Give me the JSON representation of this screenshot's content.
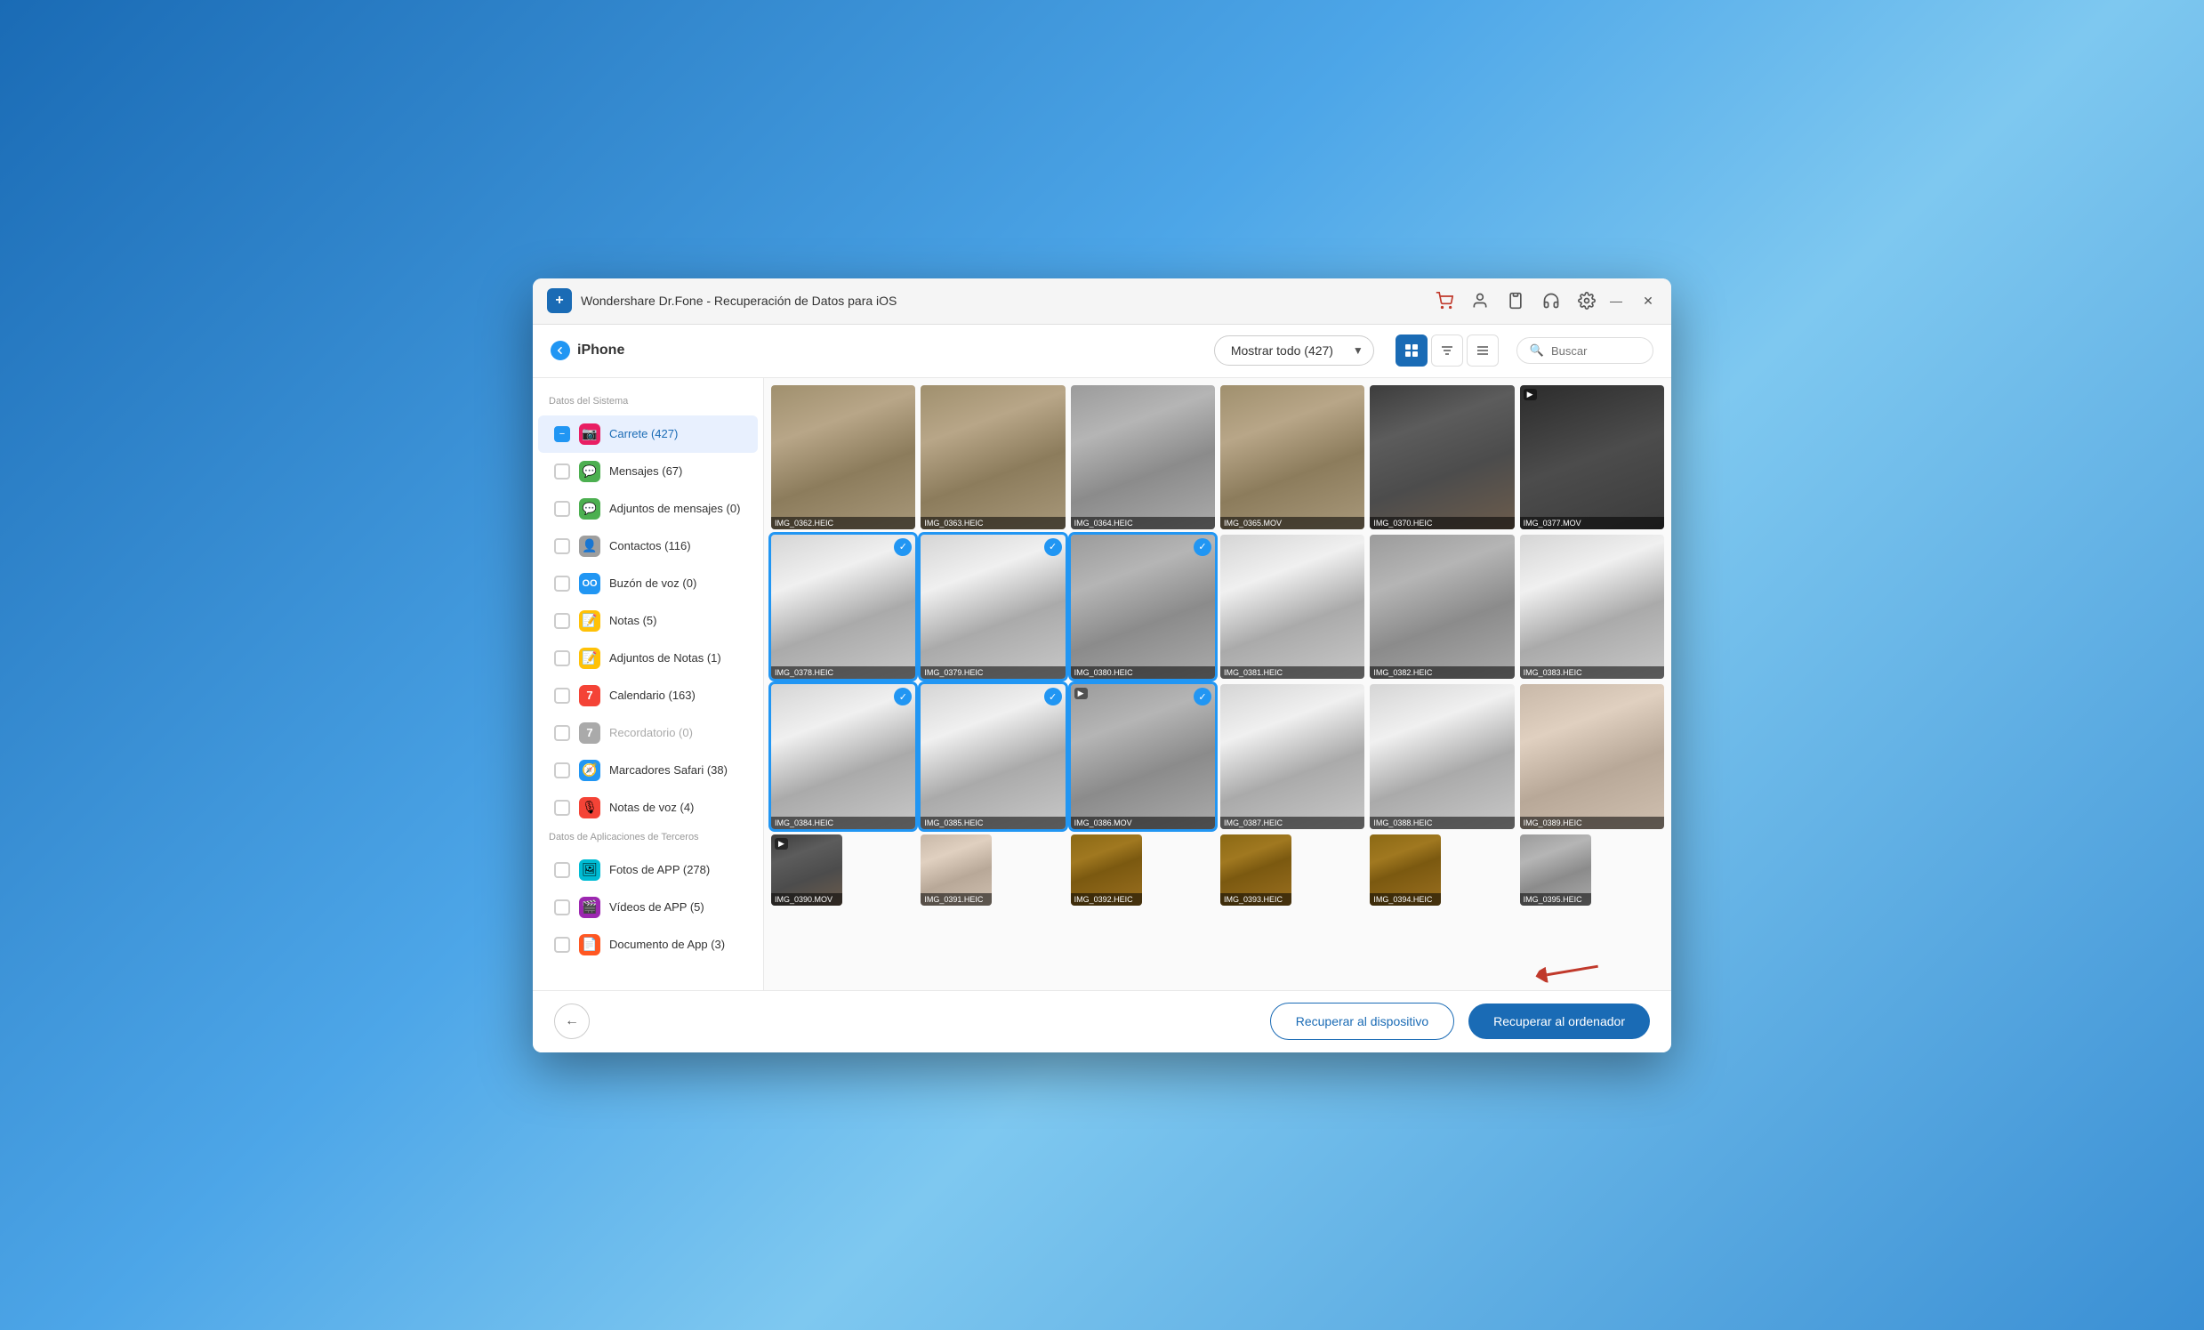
{
  "app": {
    "title": "Wondershare Dr.Fone - Recuperación de Datos para iOS",
    "logo_symbol": "+"
  },
  "titlebar": {
    "icons": [
      "cart-icon",
      "user-icon",
      "clipboard-icon",
      "headset-icon",
      "gear-icon"
    ],
    "minimize_label": "—",
    "close_label": "✕"
  },
  "toolbar": {
    "device_name": "iPhone",
    "dropdown_label": "Mostrar todo (427)",
    "search_placeholder": "Buscar",
    "view_grid_label": "⊞",
    "view_list_label": "☰",
    "view_other_label": "⊟"
  },
  "sidebar": {
    "system_data_title": "Datos del Sistema",
    "items": [
      {
        "id": "carrete",
        "label": "Carrete (427)",
        "icon": "📷",
        "icon_bg": "#E91E63",
        "checked": true,
        "active": true
      },
      {
        "id": "mensajes",
        "label": "Mensajes (67)",
        "icon": "💬",
        "icon_bg": "#4CAF50",
        "checked": false
      },
      {
        "id": "adjuntos-mensajes",
        "label": "Adjuntos de mensajes (0)",
        "icon": "💬",
        "icon_bg": "#4CAF50",
        "checked": false
      },
      {
        "id": "contactos",
        "label": "Contactos (116)",
        "icon": "👤",
        "icon_bg": "#9E9E9E",
        "checked": false
      },
      {
        "id": "buzon",
        "label": "Buzón de voz (0)",
        "icon": "🔵",
        "icon_bg": "#2196F3",
        "checked": false
      },
      {
        "id": "notas",
        "label": "Notas (5)",
        "icon": "📝",
        "icon_bg": "#FFC107",
        "checked": false
      },
      {
        "id": "adjuntos-notas",
        "label": "Adjuntos de Notas (1)",
        "icon": "📝",
        "icon_bg": "#FFC107",
        "checked": false
      },
      {
        "id": "calendario",
        "label": "Calendario (163)",
        "icon": "7",
        "icon_bg": "#F44336",
        "checked": false
      },
      {
        "id": "recordatorio",
        "label": "Recordatorio (0)",
        "icon": "7",
        "icon_bg": "#888",
        "checked": false
      },
      {
        "id": "marcadores",
        "label": "Marcadores Safari (38)",
        "icon": "🧭",
        "icon_bg": "#2196F3",
        "checked": false
      },
      {
        "id": "notas-voz",
        "label": "Notas de voz (4)",
        "icon": "🎙",
        "icon_bg": "#F44336",
        "checked": false
      }
    ],
    "third_party_title": "Datos de Aplicaciones de Terceros",
    "third_party_items": [
      {
        "id": "fotos-app",
        "label": "Fotos de APP (278)",
        "icon": "🖼",
        "icon_bg": "#00BCD4",
        "checked": false
      },
      {
        "id": "videos-app",
        "label": "Vídeos de APP (5)",
        "icon": "🎬",
        "icon_bg": "#9C27B0",
        "checked": false
      },
      {
        "id": "doc-app",
        "label": "Documento de App (3)",
        "icon": "📄",
        "icon_bg": "#FF5722",
        "checked": false
      }
    ]
  },
  "photos": {
    "rows": [
      [
        {
          "name": "IMG_0362.HEIC",
          "selected": false,
          "color": "cat-back",
          "video": false
        },
        {
          "name": "IMG_0363.HEIC",
          "selected": false,
          "color": "cat-back",
          "video": false
        },
        {
          "name": "IMG_0364.HEIC",
          "selected": false,
          "color": "cat-gray",
          "video": false
        },
        {
          "name": "IMG_0365.MOV",
          "selected": false,
          "color": "cat-back",
          "video": true
        },
        {
          "name": "IMG_0370.HEIC",
          "selected": false,
          "color": "room-dark",
          "video": false
        },
        {
          "name": "IMG_0377.MOV",
          "selected": false,
          "color": "room-dark",
          "video": true
        }
      ],
      [
        {
          "name": "IMG_0378.HEIC",
          "selected": true,
          "color": "cat-white-gray",
          "video": false
        },
        {
          "name": "IMG_0379.HEIC",
          "selected": true,
          "color": "cat-white-gray",
          "video": false
        },
        {
          "name": "IMG_0380.HEIC",
          "selected": true,
          "color": "cat-gray",
          "video": false
        },
        {
          "name": "IMG_0381.HEIC",
          "selected": false,
          "color": "cat-white-gray",
          "video": false
        },
        {
          "name": "IMG_0382.HEIC",
          "selected": false,
          "color": "cat-gray",
          "video": false
        },
        {
          "name": "IMG_0383.HEIC",
          "selected": false,
          "color": "cat-white-gray",
          "video": false
        }
      ],
      [
        {
          "name": "IMG_0384.HEIC",
          "selected": true,
          "color": "cat-white-gray",
          "video": false
        },
        {
          "name": "IMG_0385.HEIC",
          "selected": true,
          "color": "cat-white-gray",
          "video": false
        },
        {
          "name": "IMG_0386.MOV",
          "selected": true,
          "color": "cat-gray",
          "video": true
        },
        {
          "name": "IMG_0387.HEIC",
          "selected": false,
          "color": "cat-white-gray",
          "video": false
        },
        {
          "name": "IMG_0388.HEIC",
          "selected": false,
          "color": "cat-white-gray",
          "video": false
        },
        {
          "name": "IMG_0389.HEIC",
          "selected": false,
          "color": "hand-cat",
          "video": false
        }
      ],
      [
        {
          "name": "IMG_0390.MOV",
          "selected": false,
          "color": "room-dark",
          "video": true
        },
        {
          "name": "IMG_0391.HEIC",
          "selected": false,
          "color": "hand-cat",
          "video": false
        },
        {
          "name": "IMG_0392.HEIC",
          "selected": false,
          "color": "bed-brown",
          "video": false
        },
        {
          "name": "IMG_0393.HEIC",
          "selected": false,
          "color": "bed-brown",
          "video": false
        },
        {
          "name": "IMG_0394.HEIC",
          "selected": false,
          "color": "bed-brown",
          "video": false
        },
        {
          "name": "IMG_0395.HEIC",
          "selected": false,
          "color": "cat-gray",
          "video": false
        }
      ]
    ]
  },
  "footer": {
    "back_label": "←",
    "recover_device_label": "Recuperar al dispositivo",
    "recover_computer_label": "Recuperar al ordenador"
  }
}
